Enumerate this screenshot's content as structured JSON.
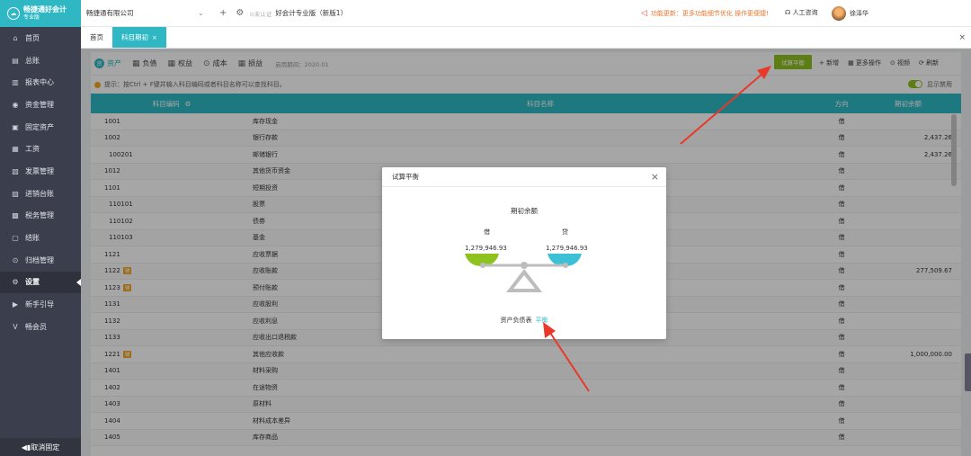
{
  "brand": {
    "name": "畅捷通好会计",
    "sub": "专业版"
  },
  "sidebar": {
    "items": [
      {
        "icon": "home-icon",
        "glyph": "⌂",
        "label": "首页"
      },
      {
        "icon": "ledger-icon",
        "glyph": "▤",
        "label": "总账"
      },
      {
        "icon": "report-icon",
        "glyph": "▥",
        "label": "报表中心"
      },
      {
        "icon": "fund-icon",
        "glyph": "◉",
        "label": "资金管理"
      },
      {
        "icon": "asset-icon",
        "glyph": "▣",
        "label": "固定资产"
      },
      {
        "icon": "salary-icon",
        "glyph": "▦",
        "label": "工资"
      },
      {
        "icon": "invoice-icon",
        "glyph": "▧",
        "label": "发票管理"
      },
      {
        "icon": "sales-icon",
        "glyph": "▨",
        "label": "进销台账"
      },
      {
        "icon": "tax-icon",
        "glyph": "▩",
        "label": "税务管理"
      },
      {
        "icon": "close-account-icon",
        "glyph": "▢",
        "label": "结账"
      },
      {
        "icon": "archive-icon",
        "glyph": "⊙",
        "label": "归档管理"
      },
      {
        "icon": "settings-icon",
        "glyph": "⚙",
        "label": "设置",
        "active": true
      },
      {
        "icon": "guide-icon",
        "glyph": "▶",
        "label": "新手引导"
      },
      {
        "icon": "vip-icon",
        "glyph": "V",
        "label": "畅会员"
      }
    ],
    "unpin": "◀▮取消固定"
  },
  "topbar": {
    "company": "畅捷通有限公司",
    "badge": "⊙未认证",
    "product": "好会计专业版（新版1）",
    "notice": "功能更新：更多功能细节优化 操作更便捷!",
    "help": "人工咨询",
    "user": "徐泽华"
  },
  "tabs": [
    {
      "label": "首页",
      "active": false
    },
    {
      "label": "科目期初",
      "active": true,
      "close": "×"
    }
  ],
  "close_all": "×",
  "toolbar": {
    "tabs": [
      {
        "glyph": "资",
        "label": "资产",
        "active": true
      },
      {
        "glyph": "▦",
        "label": "负债",
        "active": false
      },
      {
        "glyph": "▦",
        "label": "权益",
        "active": false
      },
      {
        "glyph": "⊙",
        "label": "成本",
        "active": false
      },
      {
        "glyph": "▦",
        "label": "损益",
        "active": false
      }
    ],
    "period": "启用期间：2020.01",
    "trial_balance": "试算平衡",
    "actions": [
      "+ 新增",
      "▦ 更多操作",
      "⊙ 视频",
      "⟳ 刷新"
    ]
  },
  "tip": {
    "text": "提示：按Ctrl + F键并输入科目编码或者科目名称可以查找科目。",
    "toggle_label": "显示禁用"
  },
  "table": {
    "headers": {
      "code": "科目编码",
      "name": "科目名称",
      "direction": "方向",
      "balance": "期初余额"
    },
    "rows": [
      {
        "code": "1001",
        "name": "库存现金",
        "dir": "借",
        "bal": "",
        "tag": ""
      },
      {
        "code": "1002",
        "name": "银行存款",
        "dir": "借",
        "bal": "2,437.26",
        "tag": ""
      },
      {
        "code": "100201",
        "name": "邮储银行",
        "dir": "借",
        "bal": "2,437.26",
        "tag": "",
        "sub": true
      },
      {
        "code": "1012",
        "name": "其他货币资金",
        "dir": "借",
        "bal": "",
        "tag": ""
      },
      {
        "code": "1101",
        "name": "短期投资",
        "dir": "借",
        "bal": "",
        "tag": ""
      },
      {
        "code": "110101",
        "name": "股票",
        "dir": "借",
        "bal": "",
        "tag": "",
        "sub": true
      },
      {
        "code": "110102",
        "name": "债券",
        "dir": "借",
        "bal": "",
        "tag": "",
        "sub": true
      },
      {
        "code": "110103",
        "name": "基金",
        "dir": "借",
        "bal": "",
        "tag": "",
        "sub": true
      },
      {
        "code": "1121",
        "name": "应收票据",
        "dir": "借",
        "bal": "",
        "tag": ""
      },
      {
        "code": "1122",
        "name": "应收账款",
        "dir": "借",
        "bal": "277,509.67",
        "tag": "辅"
      },
      {
        "code": "1123",
        "name": "预付账款",
        "dir": "借",
        "bal": "",
        "tag": "辅"
      },
      {
        "code": "1131",
        "name": "应收股利",
        "dir": "借",
        "bal": "",
        "tag": ""
      },
      {
        "code": "1132",
        "name": "应收利息",
        "dir": "借",
        "bal": "",
        "tag": ""
      },
      {
        "code": "1133",
        "name": "应收出口退税款",
        "dir": "借",
        "bal": "",
        "tag": ""
      },
      {
        "code": "1221",
        "name": "其他应收款",
        "dir": "借",
        "bal": "1,000,000.00",
        "tag": "辅"
      },
      {
        "code": "1401",
        "name": "材料采购",
        "dir": "借",
        "bal": "",
        "tag": ""
      },
      {
        "code": "1402",
        "name": "在途物资",
        "dir": "借",
        "bal": "",
        "tag": ""
      },
      {
        "code": "1403",
        "name": "原材料",
        "dir": "借",
        "bal": "",
        "tag": ""
      },
      {
        "code": "1404",
        "name": "材料成本差异",
        "dir": "借",
        "bal": "",
        "tag": ""
      },
      {
        "code": "1405",
        "name": "库存商品",
        "dir": "借",
        "bal": "",
        "tag": ""
      }
    ]
  },
  "modal": {
    "title": "试算平衡",
    "close": "×",
    "heading": "期初余额",
    "debit_label": "借",
    "credit_label": "贷",
    "debit_value": "1,279,946.93",
    "credit_value": "1,279,946.93",
    "result_label": "资产负债表",
    "result_status": "平衡",
    "colors": {
      "debit": "#8ec21f",
      "credit": "#3cc0d6",
      "beam": "#bdbdbd"
    }
  },
  "annotation_color": "#e8392b"
}
